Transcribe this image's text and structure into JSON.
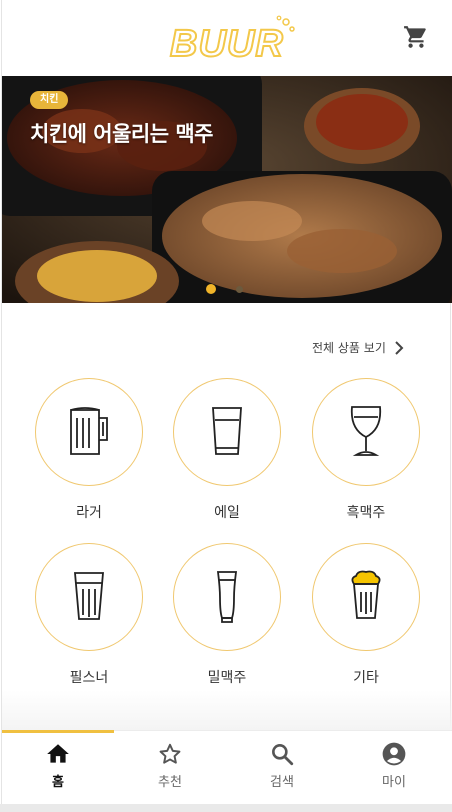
{
  "header": {
    "logo_text": "BUUR",
    "cart_icon": "cart-icon"
  },
  "banner": {
    "badge": "치킨",
    "title": "치킨에 어울리는 맥주",
    "slides_total": 2,
    "slide_active": 1
  },
  "view_all": {
    "label": "전체 상품 보기"
  },
  "categories": [
    {
      "label": "라거",
      "icon": "mug-icon"
    },
    {
      "label": "에일",
      "icon": "pint-glass-icon"
    },
    {
      "label": "흑맥주",
      "icon": "goblet-icon"
    },
    {
      "label": "필스너",
      "icon": "pilsner-glass-icon"
    },
    {
      "label": "밀맥주",
      "icon": "wheat-glass-icon"
    },
    {
      "label": "기타",
      "icon": "foam-glass-icon"
    }
  ],
  "nav": {
    "items": [
      {
        "label": "홈",
        "icon": "home-icon",
        "active": true
      },
      {
        "label": "추천",
        "icon": "star-icon",
        "active": false
      },
      {
        "label": "검색",
        "icon": "search-icon",
        "active": false
      },
      {
        "label": "마이",
        "icon": "account-icon",
        "active": false
      }
    ]
  },
  "colors": {
    "accent": "#f0b429",
    "circle_border": "#f0c870",
    "logo": "#f3c84a"
  }
}
